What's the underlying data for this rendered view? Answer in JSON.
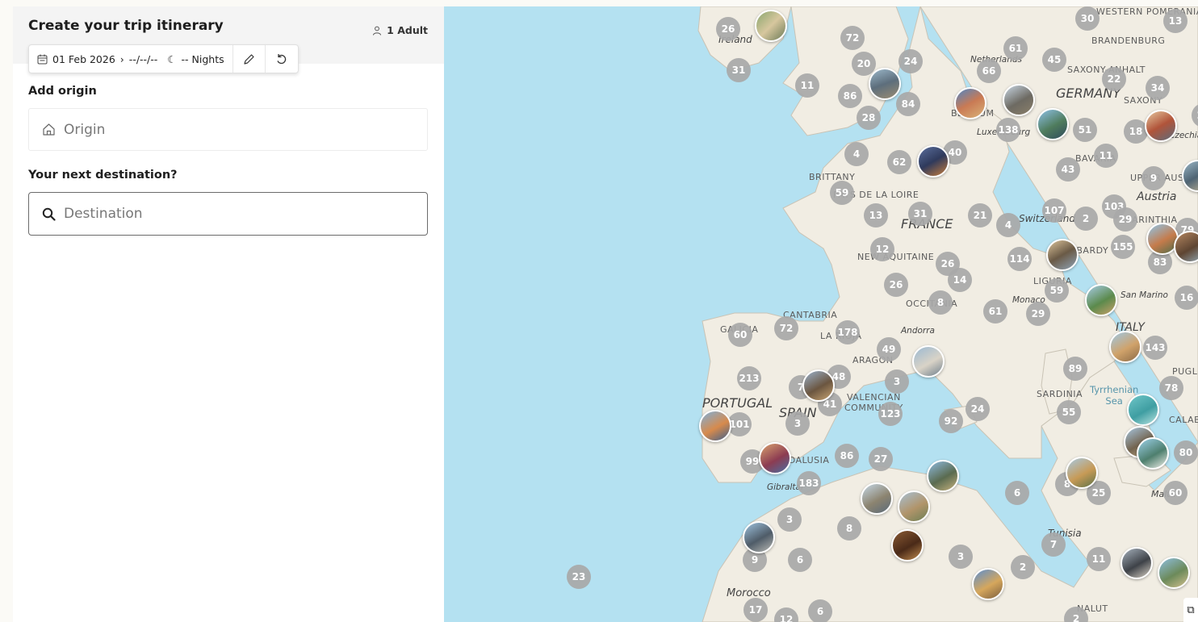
{
  "header": {
    "title": "Create your trip itinerary",
    "travellers": "1 Adult"
  },
  "dates": {
    "start": "01 Feb 2026",
    "arrow": "›",
    "end": "--/--/--",
    "nights": "-- Nights"
  },
  "origin": {
    "label": "Add origin",
    "placeholder": "Origin"
  },
  "destination": {
    "label": "Your next destination?",
    "placeholder": "Destination"
  },
  "map": {
    "labels": {
      "ireland": "Ireland",
      "western_pomerania": "WESTERN\nPOMERANIA",
      "brandenburg": "BRANDENBURG",
      "netherlands": "Netherlands",
      "saxony_anhalt": "SAXONY-ANHALT",
      "germany": "GERMANY",
      "saxony": "SAXONY",
      "luxembourg": "Luxembourg",
      "czechia": "Czechia",
      "brittany": "BRITTANY",
      "pays_de_la_loire": "PAYS DE LA LOIRE",
      "france": "FRANCE",
      "switzerland": "Switzerland",
      "austria": "Austria",
      "nouvelle_aquitaine": "NEW AQUITAINE",
      "liguria": "LIGURIA",
      "monaco": "Monaco",
      "san_marino": "San Marino",
      "occitanie": "OCCITANIA",
      "cantabria": "CANTABRIA",
      "andorra": "Andorra",
      "italy": "ITALY",
      "la_rioja": "LA RIOJA",
      "aragon": "ARAGON",
      "galicia": "GALICIA",
      "portugal": "PORTUGAL",
      "spain": "SPAIN",
      "valencian": "VALENCIAN\nCOMMUNITY",
      "sardinia": "SARDINIA",
      "tyrrhenian": "Tyrrhenian\nSea",
      "andalusia": "ANDALUSIA",
      "gibraltar": "Gibraltar",
      "tunisia": "Tunisia",
      "morocco": "Morocco",
      "malta": "Malta",
      "puglia": "PUGLIA",
      "calabria": "CALABRIA",
      "lombardy": "LOMBARDY",
      "belgium": "BELGIUM",
      "bavaria": "BAVARIA",
      "upper_austria": "UPPER AUSTRIA",
      "carinthia": "CARINTHIA",
      "kalut": "NALUT"
    },
    "clusters": [
      "26",
      "72",
      "30",
      "13",
      "61",
      "45",
      "31",
      "20",
      "24",
      "66",
      "22",
      "11",
      "86",
      "84",
      "28",
      "34",
      "26",
      "138",
      "51",
      "18",
      "4",
      "62",
      "40",
      "11",
      "43",
      "59",
      "13",
      "31",
      "21",
      "4",
      "107",
      "2",
      "103",
      "29",
      "9",
      "12",
      "26",
      "14",
      "114",
      "155",
      "83",
      "79",
      "26",
      "8",
      "59",
      "29",
      "16",
      "61",
      "60",
      "72",
      "178",
      "49",
      "3",
      "143",
      "213",
      "48",
      "7",
      "41",
      "89",
      "78",
      "101",
      "123",
      "92",
      "24",
      "55",
      "3",
      "99",
      "86",
      "27",
      "80",
      "183",
      "6",
      "8",
      "25",
      "60",
      "3",
      "8",
      "7",
      "9",
      "6",
      "3",
      "2",
      "11",
      "23",
      "17",
      "12",
      "6",
      "2"
    ]
  }
}
